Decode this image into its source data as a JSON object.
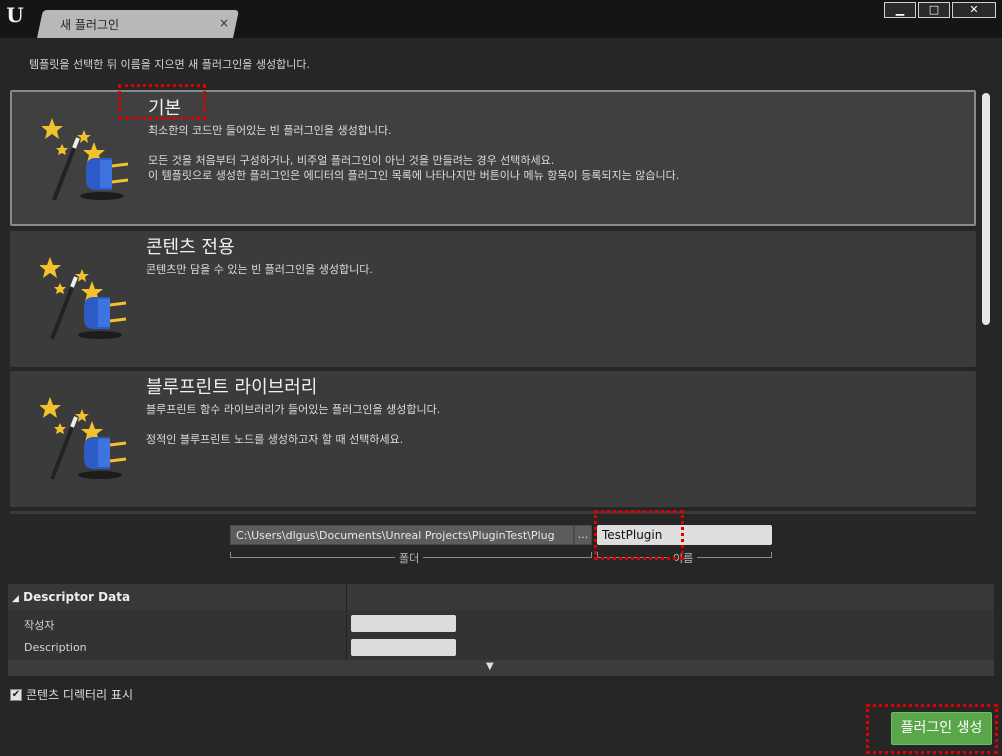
{
  "window": {
    "tab_label": "새 플러그인",
    "tab_close": "×",
    "minimize": "▁",
    "maximize": "□",
    "close": "✕"
  },
  "subtitle": "템플릿을 선택한 뒤 이름을 지으면 새 플러그인을 생성합니다.",
  "templates": [
    {
      "title": "기본",
      "desc1": "최소한의 코드만 들어있는 빈 플러그인을 생성합니다.",
      "desc2": "모든 것을 처음부터 구성하거나, 비주얼 플러그인이 아닌 것을 만들려는 경우 선택하세요.",
      "desc3": "이 템플릿으로 생성한 플러그인은 에디터의 플러그인 목록에 나타나지만 버튼이나 메뉴 항목이 등록되지는 않습니다."
    },
    {
      "title": "콘텐츠 전용",
      "desc1": "콘텐츠만 담을 수 있는 빈 플러그인을 생성합니다."
    },
    {
      "title": "블루프린트 라이브러리",
      "desc1": "블루프린트 함수 라이브러리가 들어있는 플러그인을 생성합니다.",
      "desc2": "정적인 블루프린트 노드를 생성하고자 할 때 선택하세요."
    }
  ],
  "path": {
    "value": "C:\\Users\\dlgus\\Documents\\Unreal Projects\\PluginTest\\Plug",
    "browse": "...",
    "label": "폴더"
  },
  "name": {
    "value": "TestPlugin",
    "label": "이름"
  },
  "descriptor": {
    "title": "Descriptor Data",
    "rows": [
      {
        "label": "작성자"
      },
      {
        "label": "Description"
      }
    ]
  },
  "show_content_dir": {
    "label": "콘텐츠 디렉터리 표시",
    "checked": true
  },
  "create_button": "플러그인 생성"
}
